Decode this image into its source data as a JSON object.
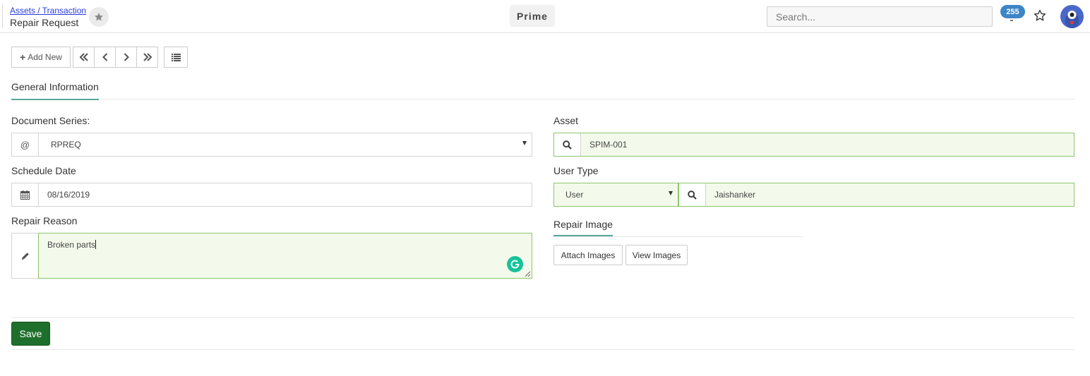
{
  "header": {
    "breadcrumb": "Assets / Transaction",
    "title": "Repair Request",
    "brand": "Prime",
    "search_placeholder": "Search...",
    "notification_count": "255"
  },
  "toolbar": {
    "add_new_label": "Add New"
  },
  "tabs": [
    {
      "label": "General Information"
    }
  ],
  "form": {
    "document_series": {
      "label": "Document Series:",
      "prefix": "@",
      "value": "RPREQ"
    },
    "schedule_date": {
      "label": "Schedule Date",
      "value": "08/16/2019"
    },
    "repair_reason": {
      "label": "Repair Reason",
      "value": "Broken parts"
    },
    "asset": {
      "label": "Asset",
      "value": "SPIM-001"
    },
    "user_type": {
      "label": "User Type",
      "type_value": "User",
      "user_value": "Jaishanker"
    }
  },
  "repair_image": {
    "title": "Repair Image",
    "attach_label": "Attach Images",
    "view_label": "View Images"
  },
  "footer": {
    "save_label": "Save"
  },
  "colors": {
    "accent": "#5aa59a",
    "valid_border": "#8cc56b",
    "valid_fill": "#f4faeb",
    "save_button": "#1e6f2b",
    "badge": "#3d85c6"
  }
}
